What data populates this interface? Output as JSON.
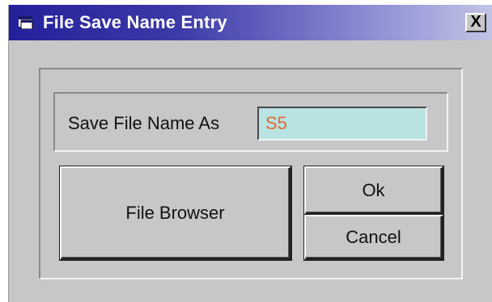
{
  "window": {
    "title": "File Save Name Entry",
    "close_glyph": "X",
    "icon": "window-app-icon"
  },
  "form": {
    "label": "Save File Name As",
    "file_name_value": "S5"
  },
  "buttons": {
    "file_browser": "File Browser",
    "ok": "Ok",
    "cancel": "Cancel"
  },
  "colors": {
    "title_bar_start": "#24209a",
    "title_bar_end": "#c2c4e6",
    "window_face": "#c7c7c7",
    "input_background": "#b9e3e3",
    "input_text": "#e06b30"
  }
}
